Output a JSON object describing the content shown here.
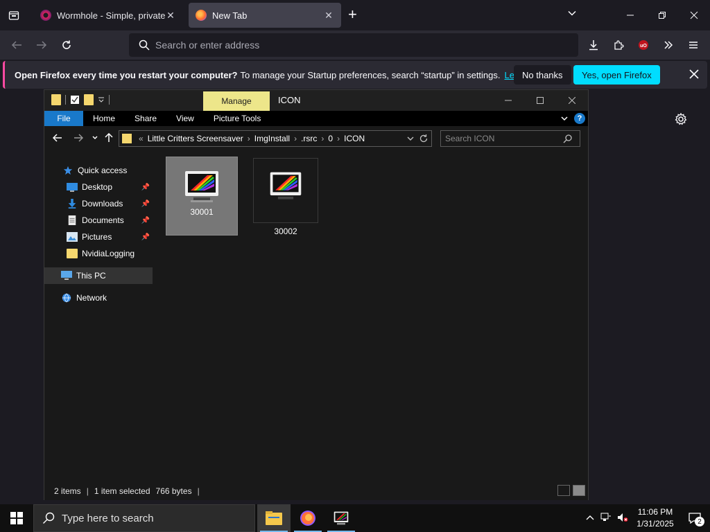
{
  "browser": {
    "tabs": [
      {
        "title": "Wormhole - Simple, private file",
        "active": false
      },
      {
        "title": "New Tab",
        "active": true
      }
    ],
    "url_placeholder": "Search or enter address",
    "notification": {
      "bold": "Open Firefox every time you restart your computer?",
      "text": "To manage your Startup preferences, search “startup” in settings.",
      "link": "Learn more",
      "no_button": "No thanks",
      "yes_button": "Yes, open Firefox"
    }
  },
  "explorer": {
    "title": "ICON",
    "manage_label": "Manage",
    "ribbon_tabs": [
      "File",
      "Home",
      "Share",
      "View",
      "Picture Tools"
    ],
    "breadcrumb": [
      "Little Critters Screensaver",
      "ImgInstall",
      ".rsrc",
      "0",
      "ICON"
    ],
    "search_placeholder": "Search ICON",
    "nav_items": [
      {
        "label": "Quick access",
        "icon": "star-icon"
      },
      {
        "label": "Desktop",
        "icon": "desktop-icon",
        "pinned": true
      },
      {
        "label": "Downloads",
        "icon": "download-icon",
        "pinned": true
      },
      {
        "label": "Documents",
        "icon": "document-icon",
        "pinned": true
      },
      {
        "label": "Pictures",
        "icon": "pictures-icon",
        "pinned": true
      },
      {
        "label": "NvidiaLogging",
        "icon": "folder-icon"
      },
      {
        "label": "This PC",
        "icon": "computer-icon",
        "selected": true
      },
      {
        "label": "Network",
        "icon": "network-icon"
      }
    ],
    "files": [
      {
        "name": "30001",
        "selected": true
      },
      {
        "name": "30002",
        "selected": false
      }
    ],
    "status": {
      "count": "2 items",
      "selected": "1 item selected",
      "size": "766 bytes"
    }
  },
  "taskbar": {
    "search_placeholder": "Type here to search",
    "time": "11:06 PM",
    "date": "1/31/2025",
    "notification_count": "2"
  },
  "colors": {
    "firefox_accent": "#00ddff",
    "manage_tab": "#ede68a",
    "file_tab": "#1979ca"
  }
}
